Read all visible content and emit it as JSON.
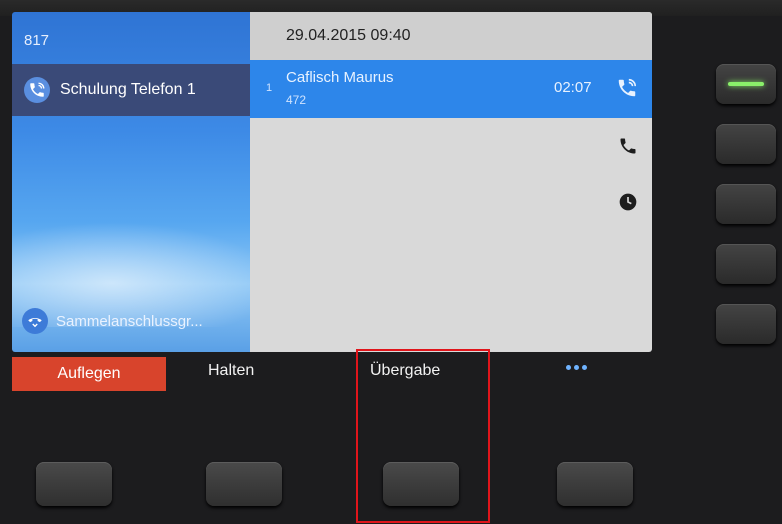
{
  "screen": {
    "extension": "817",
    "line": {
      "label": "Schulung Telefon 1",
      "icon": "phone-active-icon"
    },
    "hunt_group": {
      "label": "Sammelanschlussgr...",
      "icon": "hunt-group-icon"
    },
    "datetime": "29.04.2015 09:40",
    "call": {
      "index": "1",
      "name": "Caflisch Maurus",
      "number": "472",
      "duration": "02:07",
      "icon": "active-call-icon"
    },
    "side_icons": [
      "phone-icon",
      "clock-icon"
    ]
  },
  "softkeys": {
    "hangup": "Auflegen",
    "hold": "Halten",
    "transfer": "Übergabe",
    "more": "more-icon"
  },
  "colors": {
    "hangup": "#d8442c",
    "call_row": "#2d86ea",
    "line_row": "#3a4a78",
    "highlight": "#e0151b",
    "line_led": "#8af06a"
  }
}
